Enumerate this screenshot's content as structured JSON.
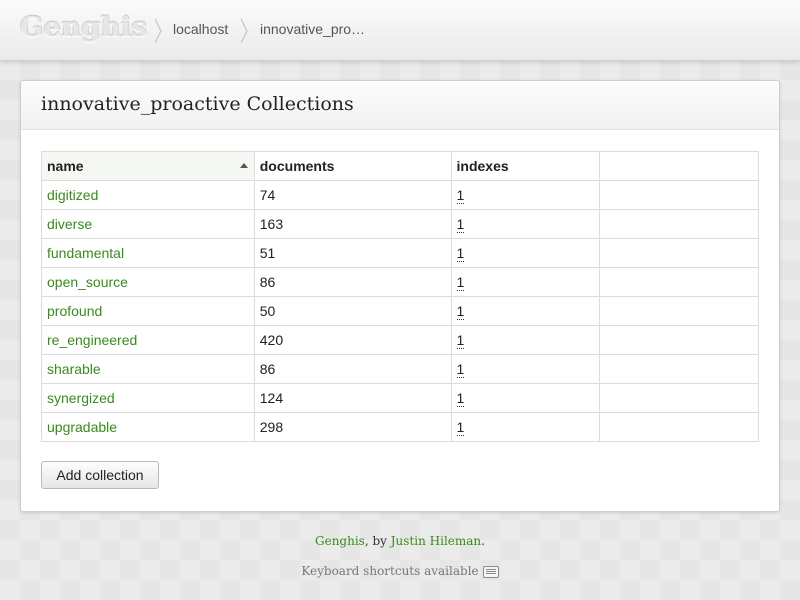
{
  "header": {
    "brand": "Genghis",
    "breadcrumbs": [
      "localhost",
      "innovative_pro…"
    ]
  },
  "panel": {
    "title": "innovative_proactive Collections",
    "columns": [
      "name",
      "documents",
      "indexes",
      ""
    ],
    "sorted_column": "name",
    "rows": [
      {
        "name": "digitized",
        "documents": "74",
        "indexes": "1"
      },
      {
        "name": "diverse",
        "documents": "163",
        "indexes": "1"
      },
      {
        "name": "fundamental",
        "documents": "51",
        "indexes": "1"
      },
      {
        "name": "open_source",
        "documents": "86",
        "indexes": "1"
      },
      {
        "name": "profound",
        "documents": "50",
        "indexes": "1"
      },
      {
        "name": "re_engineered",
        "documents": "420",
        "indexes": "1"
      },
      {
        "name": "sharable",
        "documents": "86",
        "indexes": "1"
      },
      {
        "name": "synergized",
        "documents": "124",
        "indexes": "1"
      },
      {
        "name": "upgradable",
        "documents": "298",
        "indexes": "1"
      }
    ],
    "add_button": "Add collection"
  },
  "footer": {
    "app_link": "Genghis",
    "by_text": ", by ",
    "author_link": "Justin Hileman",
    "period": ".",
    "shortcuts_text": "Keyboard shortcuts available"
  },
  "colors": {
    "link": "#3a8a1c",
    "background": "#e6e6e6"
  },
  "icons": {
    "sort": "sort-ascending-icon",
    "keyboard": "keyboard-icon"
  }
}
